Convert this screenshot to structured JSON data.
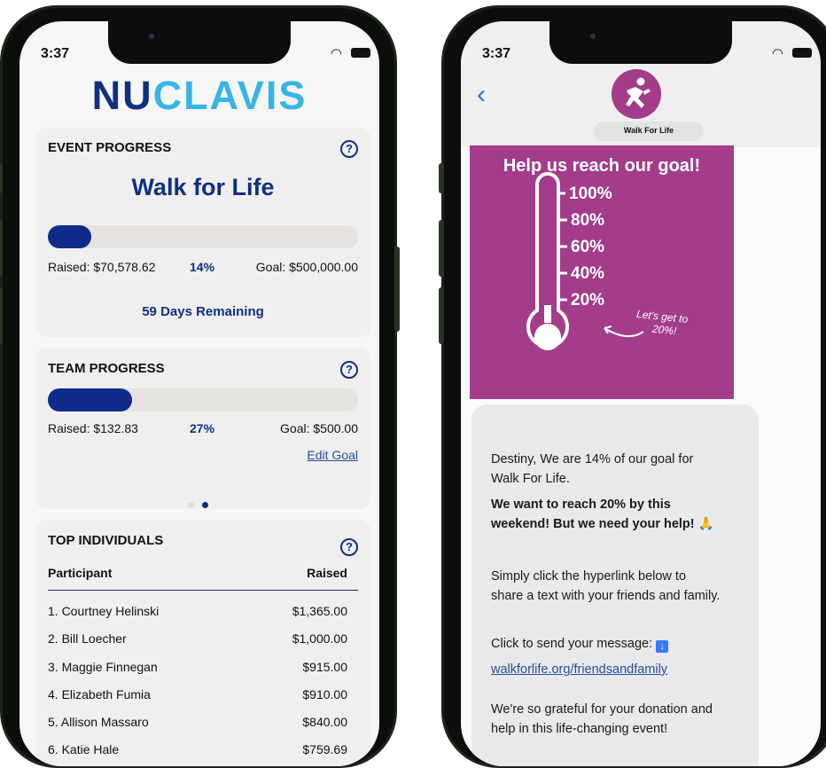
{
  "left_phone": {
    "status_time": "3:37",
    "logo": {
      "part1": "NU",
      "part2": "CLAVIS"
    },
    "event_progress": {
      "title": "EVENT PROGRESS",
      "help_icon": "question-icon",
      "event_name": "Walk for Life",
      "progress_fraction": 0.14,
      "raised": "Raised: $70,578.62",
      "percent": "14%",
      "goal": "Goal: $500,000.00",
      "days_remaining": "59 Days Remaining"
    },
    "team_progress": {
      "title": "TEAM PROGRESS",
      "help_icon": "question-icon",
      "progress_fraction": 0.27,
      "raised": "Raised: $132.83",
      "percent": "27%",
      "goal": "Goal: $500.00",
      "edit_goal": "Edit Goal"
    },
    "top_individuals": {
      "title": "TOP INDIVIDUALS",
      "help_icon": "question-icon",
      "columns": [
        "Participant",
        "Raised"
      ],
      "rows": [
        {
          "name": "1.  Courtney Helinski",
          "raised": "$1,365.00"
        },
        {
          "name": "2.  Bill Loecher",
          "raised": "$1,000.00"
        },
        {
          "name": "3.  Maggie Finnegan",
          "raised": "$915.00"
        },
        {
          "name": "4.  Elizabeth Fumia",
          "raised": "$910.00"
        },
        {
          "name": "5.  Allison Massaro",
          "raised": "$840.00"
        },
        {
          "name": "6.  Katie Hale",
          "raised": "$759.69"
        }
      ]
    }
  },
  "right_phone": {
    "status_time": "3:37",
    "back_icon": "chevron-left-icon",
    "contact_name": "Walk For Life",
    "contact_icon": "runner-icon",
    "poster": {
      "title": "Help us reach our goal!",
      "levels": [
        "100%",
        "80%",
        "60%",
        "40%",
        "20%"
      ],
      "annotation_line1": "Let's get to",
      "annotation_line2": "20%!"
    },
    "message": {
      "p1": "Destiny, We are 14% of our goal for Walk For Life.",
      "p2": "We want to reach 20% by this weekend! But we need your help!",
      "p2_icon": "praying-hands-icon",
      "p3": "Simply click the hyperlink below to share a text with your friends and family.",
      "p4": "Click to send your message:",
      "p4_icon": "down-arrow-icon",
      "link": "walkforlife.org/friendsandfamily",
      "p5": "We're so grateful for your donation and help in this life-changing event!"
    }
  },
  "colors": {
    "navy": "#10307f",
    "light_blue": "#37b5e4",
    "magenta": "#a33c8a",
    "ios_blue": "#2f6fe0"
  }
}
